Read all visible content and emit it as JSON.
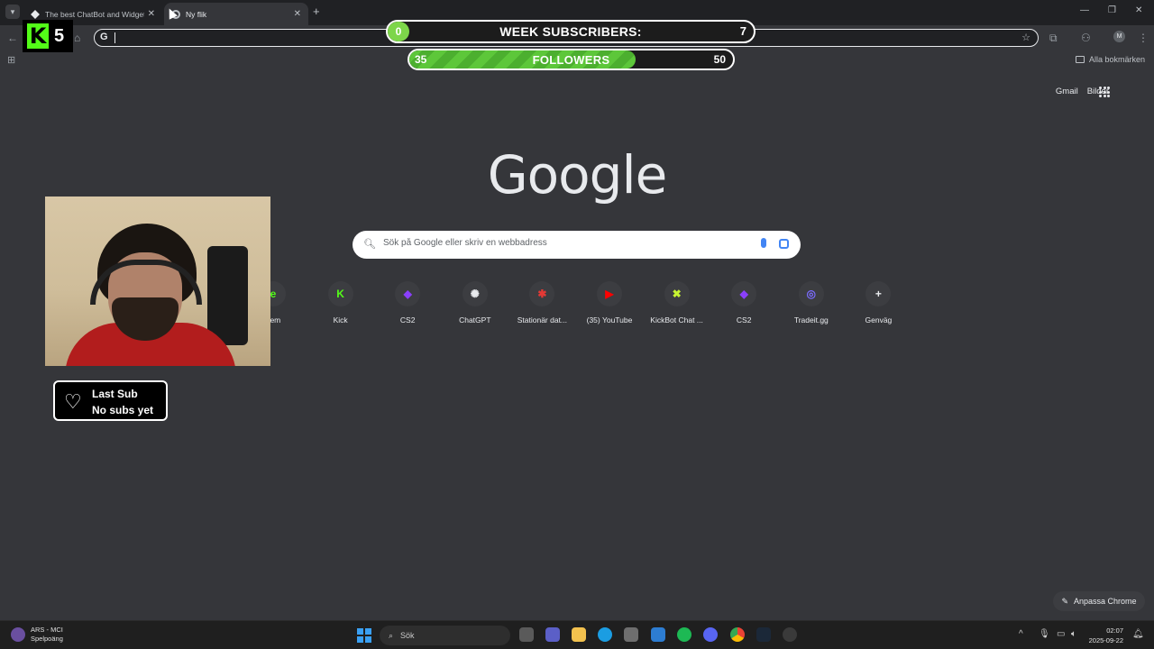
{
  "browser": {
    "tabs": [
      {
        "title": "The best ChatBot and Widgets",
        "active": false
      },
      {
        "title": "Ny flik",
        "active": true
      }
    ],
    "new_tab_symbol": "+",
    "close_symbol": "✕",
    "window_controls": {
      "minimize": "—",
      "restore": "❐",
      "close": "✕"
    },
    "omnibox": {
      "google_glyph": "G",
      "value": ""
    },
    "bookmarks_bar": {
      "all_bookmarks": "Alla bokmärken"
    }
  },
  "overlay": {
    "kick_count": "5",
    "week_subs": {
      "current": "0",
      "label": "WEEK SUBSCRIBERS:",
      "goal": "7"
    },
    "followers": {
      "current": "35",
      "label": "FOLLOWERS",
      "goal": "50",
      "progress": 0.7
    },
    "last_sub": {
      "title": "Last Sub",
      "value": "No subs yet"
    }
  },
  "ntp": {
    "top_links": [
      "Gmail",
      "Bilder"
    ],
    "logo": "Google",
    "search_placeholder": "Sök på Google eller skriv en webbadress",
    "shortcuts": [
      {
        "label": "nem",
        "glyph": "e",
        "color": "#53fc18"
      },
      {
        "label": "Kick",
        "glyph": "K",
        "color": "#53fc18"
      },
      {
        "label": "CS2",
        "glyph": "◆",
        "color": "#8a3ffc"
      },
      {
        "label": "ChatGPT",
        "glyph": "✺",
        "color": "#e8eaed"
      },
      {
        "label": "Stationär dat...",
        "glyph": "✱",
        "color": "#e53935"
      },
      {
        "label": "(35) YouTube",
        "glyph": "▶",
        "color": "#ff0000"
      },
      {
        "label": "KickBot Chat ...",
        "glyph": "✖",
        "color": "#c6f432"
      },
      {
        "label": "CS2",
        "glyph": "◆",
        "color": "#8a3ffc"
      },
      {
        "label": "Tradeit.gg",
        "glyph": "◎",
        "color": "#7b6cff"
      },
      {
        "label": "Genväg",
        "glyph": "+",
        "color": "#e8eaed"
      }
    ],
    "customize_label": "Anpassa Chrome"
  },
  "taskbar": {
    "weather": {
      "line1": "ARS - MCI",
      "line2": "Spelpoäng"
    },
    "search_label": "Sök",
    "clock": {
      "time": "02:07",
      "date": "2025-09-22"
    }
  }
}
